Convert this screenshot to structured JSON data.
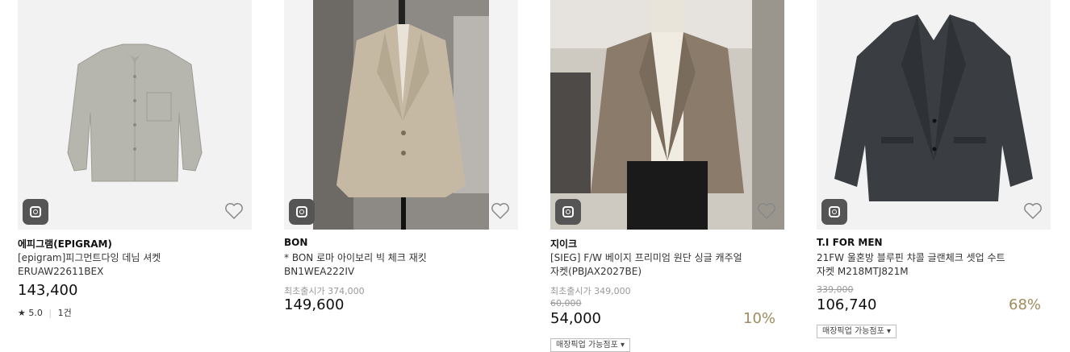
{
  "products": [
    {
      "brand": "에피그램(EPIGRAM)",
      "name_line1": "[epigram]피그먼트다잉 데님 셔켓",
      "name_line2": "ERUAW22611BEX",
      "price": "143,400",
      "rating_star": "★",
      "rating": "5.0",
      "reviews": "1건",
      "icons": [
        "instagram-icon",
        "heart-icon"
      ]
    },
    {
      "brand": "BON",
      "name_line1": "* BON 로마 아이보리 빅 체크 재킷",
      "name_line2": "BN1WEA222IV",
      "first_release_price": "최초출시가 374,000",
      "price": "149,600",
      "icons": [
        "instagram-icon",
        "heart-icon"
      ]
    },
    {
      "brand": "지이크",
      "name_line1": "[SIEG] F/W 베이지 프리미엄 원단 싱글 캐주얼",
      "name_line2": "자켓(PBJAX2027BE)",
      "first_release_price": "최초출시가 349,000",
      "original_price": "60,000",
      "price": "54,000",
      "discount": "10%",
      "store_pickup": "매장픽업 가능점포 ▾",
      "icons": [
        "instagram-icon",
        "heart-icon"
      ]
    },
    {
      "brand": "T.I FOR MEN",
      "name_line1": "21FW 울혼방 블루핀 챠콜 글랜체크 셋업 수트",
      "name_line2": "자켓 M218MTJ821M",
      "original_price": "339,000",
      "price": "106,740",
      "discount": "68%",
      "store_pickup": "매장픽업 가능점포 ▾",
      "icons": [
        "instagram-icon",
        "heart-icon"
      ]
    }
  ],
  "colors": {
    "discount": "#a08b5e",
    "thumb_bg": "#f3f3f3",
    "insta_bg": "#555555"
  }
}
